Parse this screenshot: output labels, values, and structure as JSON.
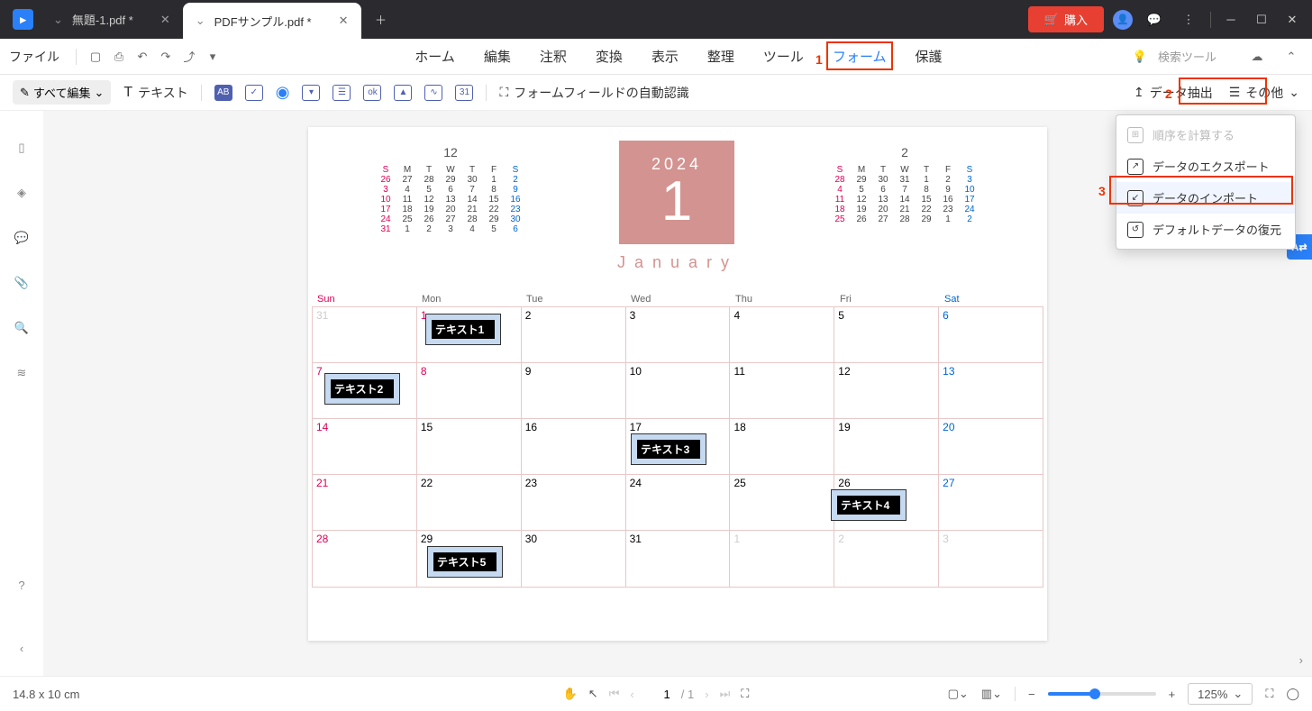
{
  "titlebar": {
    "tabs": [
      {
        "label": "無題-1.pdf *"
      },
      {
        "label": "PDFサンプル.pdf *"
      }
    ],
    "buy": "購入"
  },
  "menubar": {
    "file": "ファイル",
    "tabs": [
      "ホーム",
      "編集",
      "注釈",
      "変換",
      "表示",
      "整理",
      "ツール",
      "フォーム",
      "保護"
    ],
    "search": "検索ツール"
  },
  "toolbar": {
    "edit_all": "すべて編集",
    "text": "テキスト",
    "auto_rec": "フォームフィールドの自動認識",
    "extract": "データ抽出",
    "more": "その他"
  },
  "annotations": {
    "n1": "1",
    "n2": "2",
    "n3": "3"
  },
  "dropdown": {
    "order": "順序を計算する",
    "export": "データのエクスポート",
    "import": "データのインポート",
    "restore": "デフォルトデータの復元"
  },
  "calendar": {
    "year": "2024",
    "big": "1",
    "month": "January",
    "mini_left": {
      "title": "12",
      "hdr": [
        "S",
        "M",
        "T",
        "W",
        "T",
        "F",
        "S"
      ]
    },
    "mini_right": {
      "title": "2",
      "hdr": [
        "S",
        "M",
        "T",
        "W",
        "T",
        "F",
        "S"
      ]
    },
    "hdr": [
      "Sun",
      "Mon",
      "Tue",
      "Wed",
      "Thu",
      "Fri",
      "Sat"
    ],
    "fields": [
      "テキスト1",
      "テキスト2",
      "テキスト3",
      "テキスト4",
      "テキスト5"
    ],
    "rows": [
      [
        {
          "n": "31",
          "dim": true
        },
        {
          "n": "1",
          "sun": true
        },
        {
          "n": "2"
        },
        {
          "n": "3"
        },
        {
          "n": "4"
        },
        {
          "n": "5"
        },
        {
          "n": "6",
          "sat": true
        }
      ],
      [
        {
          "n": "7",
          "sun": true
        },
        {
          "n": "8",
          "sun": true
        },
        {
          "n": "9"
        },
        {
          "n": "10"
        },
        {
          "n": "11"
        },
        {
          "n": "12"
        },
        {
          "n": "13",
          "sat": true
        }
      ],
      [
        {
          "n": "14",
          "sun": true
        },
        {
          "n": "15"
        },
        {
          "n": "16"
        },
        {
          "n": "17"
        },
        {
          "n": "18"
        },
        {
          "n": "19"
        },
        {
          "n": "20",
          "sat": true
        }
      ],
      [
        {
          "n": "21",
          "sun": true
        },
        {
          "n": "22"
        },
        {
          "n": "23"
        },
        {
          "n": "24"
        },
        {
          "n": "25"
        },
        {
          "n": "26"
        },
        {
          "n": "27",
          "sat": true
        }
      ],
      [
        {
          "n": "28",
          "sun": true
        },
        {
          "n": "29"
        },
        {
          "n": "30"
        },
        {
          "n": "31"
        },
        {
          "n": "1",
          "dim": true
        },
        {
          "n": "2",
          "dim": true
        },
        {
          "n": "3",
          "dim": true
        }
      ]
    ]
  },
  "status": {
    "dims": "14.8 x 10 cm",
    "page": "1",
    "total": "/ 1",
    "zoom": "125%"
  },
  "mini_left_rows": [
    [
      "26",
      "27",
      "28",
      "29",
      "30",
      "1",
      "2"
    ],
    [
      "3",
      "4",
      "5",
      "6",
      "7",
      "8",
      "9"
    ],
    [
      "10",
      "11",
      "12",
      "13",
      "14",
      "15",
      "16"
    ],
    [
      "17",
      "18",
      "19",
      "20",
      "21",
      "22",
      "23"
    ],
    [
      "24",
      "25",
      "26",
      "27",
      "28",
      "29",
      "30"
    ],
    [
      "31",
      "1",
      "2",
      "3",
      "4",
      "5",
      "6"
    ]
  ],
  "mini_right_rows": [
    [
      "28",
      "29",
      "30",
      "31",
      "1",
      "2",
      "3"
    ],
    [
      "4",
      "5",
      "6",
      "7",
      "8",
      "9",
      "10"
    ],
    [
      "11",
      "12",
      "13",
      "14",
      "15",
      "16",
      "17"
    ],
    [
      "18",
      "19",
      "20",
      "21",
      "22",
      "23",
      "24"
    ],
    [
      "25",
      "26",
      "27",
      "28",
      "29",
      "1",
      "2"
    ]
  ]
}
